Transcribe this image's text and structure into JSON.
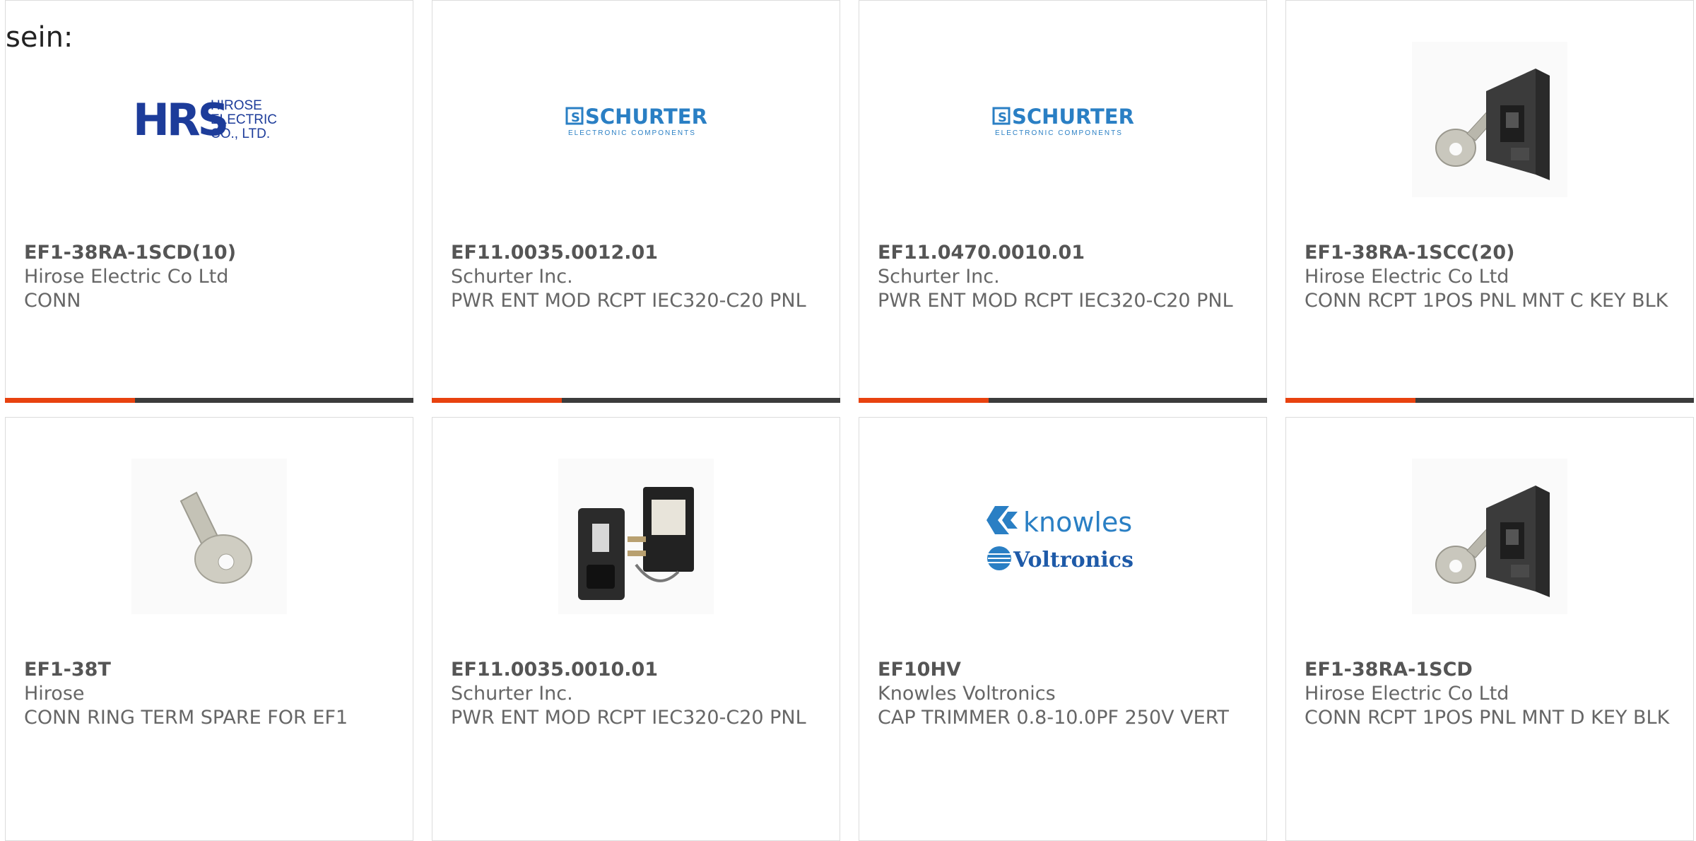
{
  "intro_text": "sein:",
  "colors": {
    "accent": "#e8420f",
    "bar": "#3c3c3c",
    "text": "#666666",
    "part": "#555555"
  },
  "products": [
    {
      "part": "EF1-38RA-1SCD(10)",
      "maker": "Hirose Electric Co Ltd",
      "desc": "CONN",
      "image": "hirose-logo",
      "logo_top": "HRS",
      "logo_lines": [
        "HIROSE",
        "ELECTRIC",
        "CO., LTD."
      ]
    },
    {
      "part": "EF11.0035.0012.01",
      "maker": "Schurter Inc.",
      "desc": "PWR ENT MOD RCPT IEC320-C20 PNL",
      "image": "schurter-logo",
      "logo_main": "SCHURTER",
      "logo_sub": "ELECTRONIC COMPONENTS"
    },
    {
      "part": "EF11.0470.0010.01",
      "maker": "Schurter Inc.",
      "desc": "PWR ENT MOD RCPT IEC320-C20 PNL",
      "image": "schurter-logo",
      "logo_main": "SCHURTER",
      "logo_sub": "ELECTRONIC COMPONENTS"
    },
    {
      "part": "EF1-38RA-1SCC(20)",
      "maker": "Hirose Electric Co Ltd",
      "desc": "CONN RCPT 1POS PNL MNT C KEY BLK",
      "image": "panel-connector-photo"
    },
    {
      "part": "EF1-38T",
      "maker": "Hirose",
      "desc": "CONN RING TERM SPARE FOR EF1",
      "image": "ring-terminal-photo"
    },
    {
      "part": "EF11.0035.0010.01",
      "maker": "Schurter Inc.",
      "desc": "PWR ENT MOD RCPT IEC320-C20 PNL",
      "image": "power-entry-module-photo"
    },
    {
      "part": "EF10HV",
      "maker": "Knowles Voltronics",
      "desc": "CAP TRIMMER 0.8-10.0PF 250V VERT",
      "image": "knowles-voltronics-logo",
      "logo_main": "knowles",
      "logo_sub": "Voltronics"
    },
    {
      "part": "EF1-38RA-1SCD",
      "maker": "Hirose Electric Co Ltd",
      "desc": "CONN RCPT 1POS PNL MNT D KEY BLK",
      "image": "panel-connector-photo"
    }
  ]
}
